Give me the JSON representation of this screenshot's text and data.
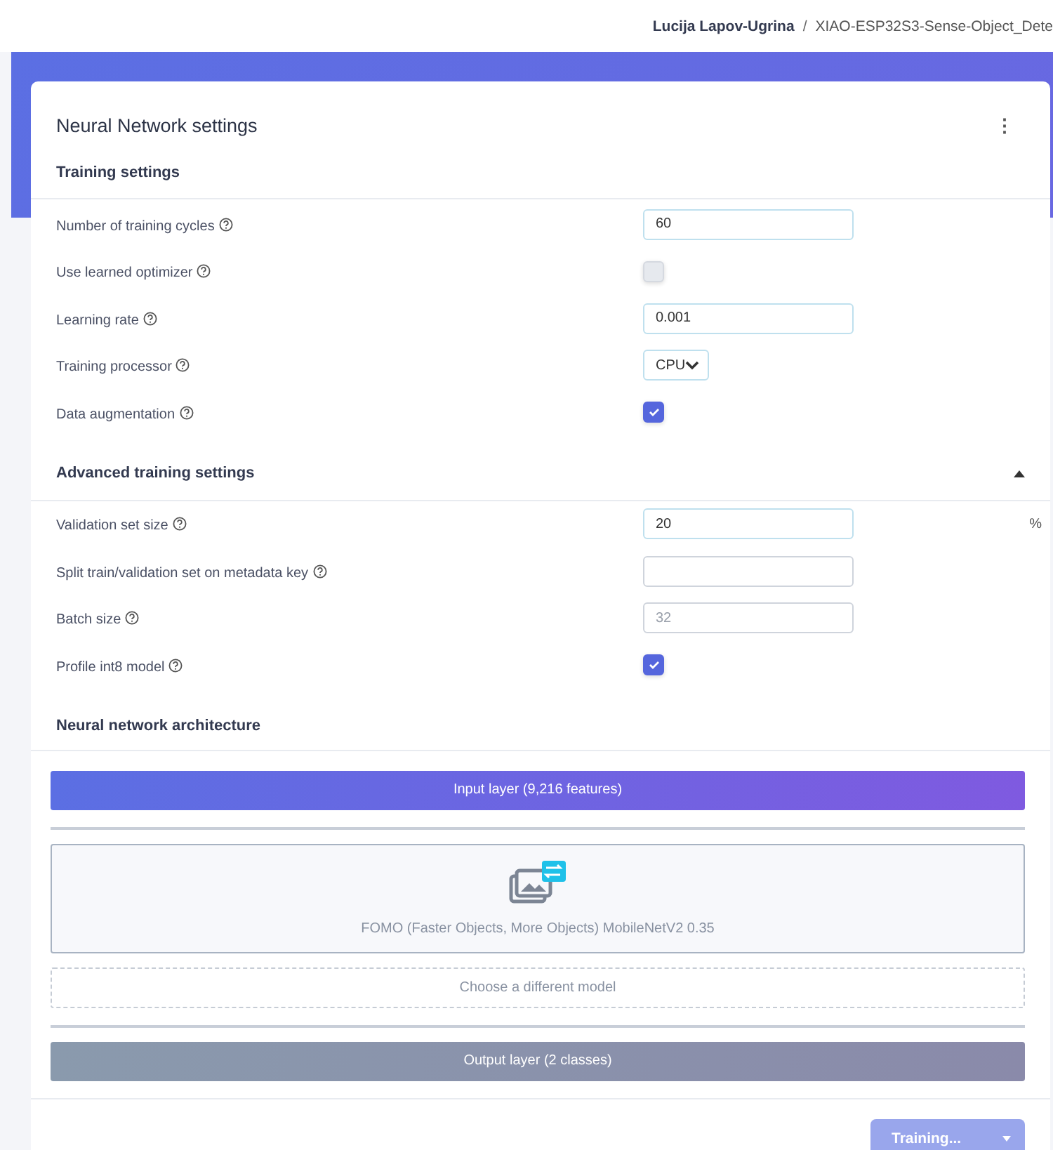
{
  "breadcrumb": {
    "user": "Lucija Lapov-Ugrina",
    "separator": "/",
    "project": "XIAO-ESP32S3-Sense-Object_Dete"
  },
  "card": {
    "title": "Neural Network settings",
    "menu_icon": "⋮"
  },
  "training_settings": {
    "title": "Training settings",
    "rows": [
      {
        "kind": "input",
        "label": "Number of training cycles",
        "value": "60"
      },
      {
        "kind": "checkbox",
        "label": "Use learned optimizer",
        "checked": false
      },
      {
        "kind": "input",
        "label": "Learning rate",
        "value": "0.001"
      },
      {
        "kind": "select",
        "label": "Training processor",
        "value": "CPU"
      },
      {
        "kind": "checkbox",
        "label": "Data augmentation",
        "checked": true
      }
    ]
  },
  "advanced_settings": {
    "title": "Advanced training settings",
    "expanded": true,
    "rows": [
      {
        "kind": "input",
        "label": "Validation set size",
        "value": "20",
        "suffix": "%"
      },
      {
        "kind": "input",
        "label": "Split train/validation set on metadata key"
      },
      {
        "kind": "input",
        "label": "Batch size",
        "placeholder": "32"
      },
      {
        "kind": "checkbox",
        "label": "Profile int8 model",
        "checked": true
      }
    ]
  },
  "architecture": {
    "title": "Neural network architecture",
    "input_layer": "Input layer (9,216 features)",
    "model": "FOMO (Faster Objects, More Objects) MobileNetV2 0.35",
    "choose_model": "Choose a different model",
    "output_layer": "Output layer (2 classes)"
  },
  "train_button": {
    "label": "Training...",
    "disabled": true
  }
}
